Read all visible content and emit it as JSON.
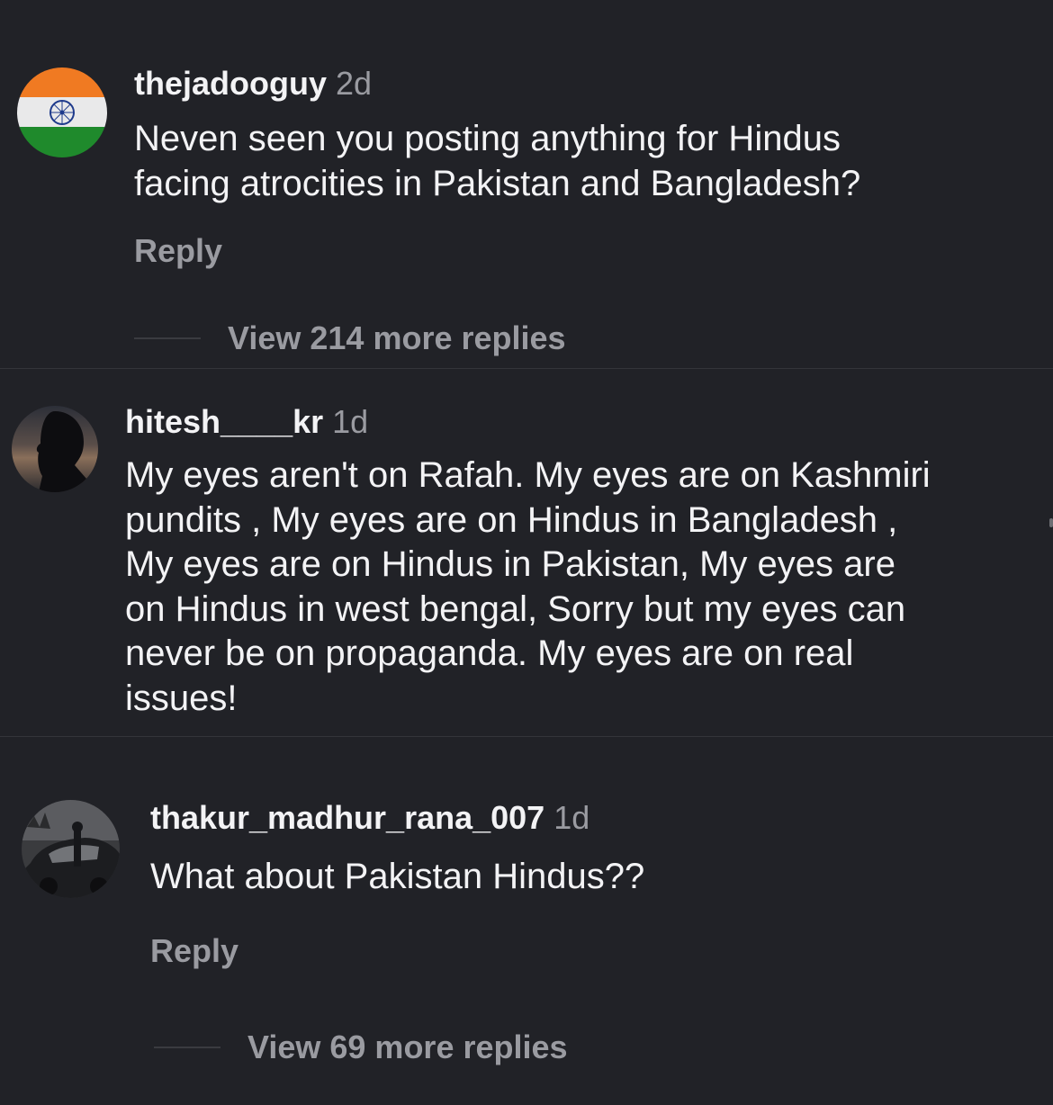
{
  "comments": [
    {
      "username": "thejadooguy",
      "time": "2d",
      "text": "Neven seen you posting anything for Hindus\nfacing atrocities in Pakistan and Bangladesh?",
      "reply_label": "Reply",
      "view_more_label": "View 214 more replies",
      "avatar_icon": "india-flag-avatar"
    },
    {
      "username": "hitesh____kr",
      "time": "1d",
      "text": "My eyes aren't on Rafah. My eyes are on Kashmiri\npundits , My eyes are on Hindus in Bangladesh ,\nMy eyes are on Hindus in Pakistan, My eyes are\non Hindus in west bengal, Sorry but my eyes can\nnever be on propaganda. My eyes are on real\nissues!",
      "avatar_icon": "silhouette-avatar"
    },
    {
      "username": "thakur_madhur_rana_007",
      "time": "1d",
      "text": "What about Pakistan Hindus??",
      "reply_label": "Reply",
      "view_more_label": "View 69 more replies",
      "avatar_icon": "car-photo-avatar"
    }
  ],
  "colors": {
    "background": "#212227",
    "text_primary": "#f3f3f5",
    "text_secondary": "#9a9ba1",
    "divider": "#34353a"
  }
}
